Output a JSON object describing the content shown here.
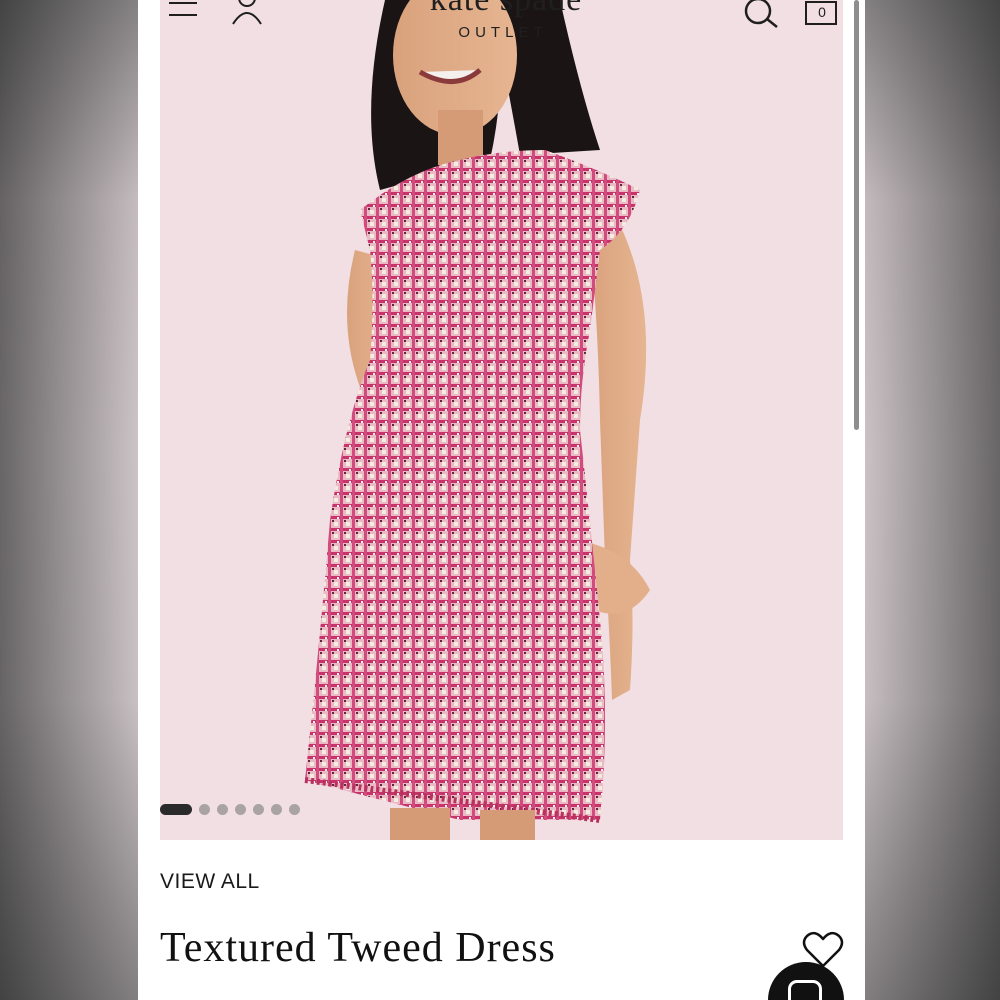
{
  "header": {
    "brand_name": "kate spade",
    "brand_sub": "OUTLET",
    "cart_count": "0",
    "icons": {
      "menu": "hamburger-icon",
      "account": "user-icon",
      "search": "search-icon",
      "cart": "shopping-bag-icon"
    }
  },
  "gallery": {
    "image_count": 7,
    "active_index": 0,
    "background_color": "#f2dfe3",
    "dress_color": "#c94d7a"
  },
  "product": {
    "view_all_label": "VIEW ALL",
    "title": "Textured Tweed Dress"
  },
  "actions": {
    "wishlist_icon": "heart-icon",
    "chat_icon": "chat-icon"
  }
}
